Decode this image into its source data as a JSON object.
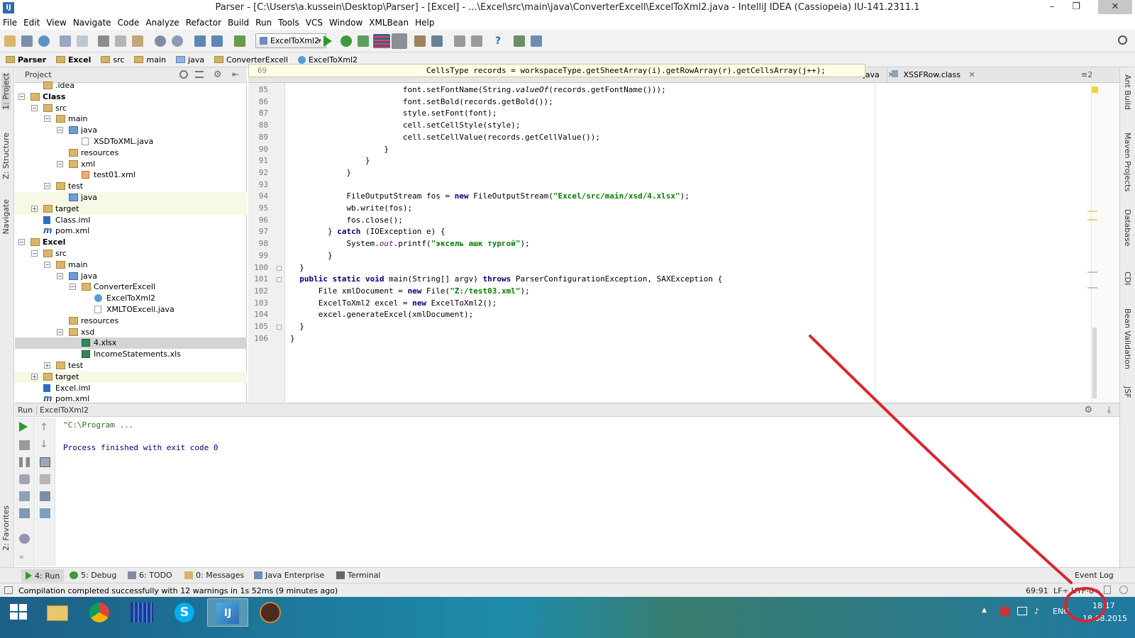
{
  "window": {
    "title": "Parser - [C:\\Users\\a.kussein\\Desktop\\Parser] - [Excel] - ...\\Excel\\src\\main\\java\\ConverterExcell\\ExcelToXml2.java - IntelliJ IDEA (Cassiopeia) IU-141.2311.1",
    "app_icon": "IJ",
    "minimize": "–",
    "maximize": "❐",
    "close": "✕"
  },
  "menu": [
    "File",
    "Edit",
    "View",
    "Navigate",
    "Code",
    "Analyze",
    "Refactor",
    "Build",
    "Run",
    "Tools",
    "VCS",
    "Window",
    "XMLBean",
    "Help"
  ],
  "toolbar": {
    "run_config": "ExcelToXml2"
  },
  "breadcrumb": [
    "Parser",
    "Excel",
    "src",
    "main",
    "java",
    "ConverterExcell",
    "ExcelToXml2"
  ],
  "left_stripe": {
    "project": "1: Project",
    "structure": "Z: Structure",
    "navigate": "Navigate",
    "favorites": "2: Favorites"
  },
  "right_stripe": [
    "Ant Build",
    "Maven Projects",
    "Database",
    "CDI",
    "Bean Validation",
    "JSF"
  ],
  "project_panel": {
    "title": "Project",
    "tree": [
      {
        "label": ".idea",
        "level": 2,
        "icon": "folder"
      },
      {
        "label": "Class",
        "level": 1,
        "icon": "folder",
        "bold": true,
        "expander": "−"
      },
      {
        "label": "src",
        "level": 2,
        "icon": "folder",
        "expander": "−"
      },
      {
        "label": "main",
        "level": 3,
        "icon": "folder",
        "expander": "−"
      },
      {
        "label": "java",
        "level": 4,
        "icon": "src",
        "expander": "−"
      },
      {
        "label": "XSDToXML.java",
        "level": 5,
        "icon": "file"
      },
      {
        "label": "resources",
        "level": 4,
        "icon": "folder"
      },
      {
        "label": "xml",
        "level": 4,
        "icon": "folder",
        "expander": "−"
      },
      {
        "label": "test01.xml",
        "level": 5,
        "icon": "xml"
      },
      {
        "label": "test",
        "level": 3,
        "icon": "folder",
        "expander": "−"
      },
      {
        "label": "java",
        "level": 4,
        "icon": "src",
        "hl": true
      },
      {
        "label": "target",
        "level": 2,
        "icon": "folder",
        "expander": "+",
        "hl": true
      },
      {
        "label": "Class.iml",
        "level": 2,
        "icon": "iml"
      },
      {
        "label": "pom.xml",
        "level": 2,
        "icon": "mvn"
      },
      {
        "label": "Excel",
        "level": 1,
        "icon": "folder",
        "bold": true,
        "expander": "−"
      },
      {
        "label": "src",
        "level": 2,
        "icon": "folder",
        "expander": "−"
      },
      {
        "label": "main",
        "level": 3,
        "icon": "folder",
        "expander": "−"
      },
      {
        "label": "java",
        "level": 4,
        "icon": "src",
        "expander": "−"
      },
      {
        "label": "ConverterExcell",
        "level": 5,
        "icon": "folder",
        "expander": "−"
      },
      {
        "label": "ExcelToXml2",
        "level": 6,
        "icon": "cls"
      },
      {
        "label": "XMLTOExcell.java",
        "level": 6,
        "icon": "file"
      },
      {
        "label": "resources",
        "level": 4,
        "icon": "folder"
      },
      {
        "label": "xsd",
        "level": 4,
        "icon": "folder",
        "expander": "−"
      },
      {
        "label": "4.xlsx",
        "level": 5,
        "icon": "xls",
        "sel": true
      },
      {
        "label": "IncomeStatements.xls",
        "level": 5,
        "icon": "xls"
      },
      {
        "label": "test",
        "level": 3,
        "icon": "folder",
        "expander": "+"
      },
      {
        "label": "target",
        "level": 2,
        "icon": "folder",
        "expander": "+",
        "hl": true
      },
      {
        "label": "Excel.iml",
        "level": 2,
        "icon": "iml"
      },
      {
        "label": "pom.xml",
        "level": 2,
        "icon": "mvn"
      }
    ]
  },
  "editor": {
    "tabs": [
      {
        "label": "...e.java",
        "icon": "file"
      },
      {
        "label": "XSSFRow.class",
        "icon": "file"
      }
    ],
    "tooltip": {
      "line": "69",
      "code": "CellsType records = workspaceType.getSheetArray(i).getRowArray(r).getCellsArray(j++);"
    },
    "lines": [
      {
        "n": "85",
        "indent": 12,
        "parts": [
          [
            "",
            "font.setFontName(String."
          ],
          [
            "i",
            "valueOf"
          ],
          [
            "",
            "(records.getFontName()));"
          ]
        ]
      },
      {
        "n": "86",
        "indent": 12,
        "parts": [
          [
            "",
            "font.setBold(records.getBold());"
          ]
        ]
      },
      {
        "n": "87",
        "indent": 12,
        "parts": [
          [
            "",
            "style.setFont(font);"
          ]
        ]
      },
      {
        "n": "88",
        "indent": 12,
        "parts": [
          [
            "",
            "cell.setCellStyle(style);"
          ]
        ]
      },
      {
        "n": "89",
        "indent": 12,
        "parts": [
          [
            "",
            "cell.setCellValue(records.getCellValue());"
          ]
        ]
      },
      {
        "n": "90",
        "indent": 10,
        "parts": [
          [
            "",
            "}"
          ]
        ]
      },
      {
        "n": "91",
        "indent": 8,
        "parts": [
          [
            "",
            "}"
          ]
        ]
      },
      {
        "n": "92",
        "indent": 6,
        "parts": [
          [
            "",
            "}"
          ]
        ]
      },
      {
        "n": "93",
        "indent": 0,
        "parts": []
      },
      {
        "n": "94",
        "indent": 6,
        "parts": [
          [
            "",
            "FileOutputStream fos = "
          ],
          [
            "k",
            "new"
          ],
          [
            "",
            " FileOutputStream("
          ],
          [
            "s",
            "\"Excel/src/main/xsd/4.xlsx\""
          ],
          [
            "",
            ");"
          ]
        ]
      },
      {
        "n": "95",
        "indent": 6,
        "parts": [
          [
            "",
            "wb.write(fos);"
          ]
        ]
      },
      {
        "n": "96",
        "indent": 6,
        "parts": [
          [
            "",
            "fos.close();"
          ]
        ]
      },
      {
        "n": "97",
        "indent": 4,
        "parts": [
          [
            "",
            "} "
          ],
          [
            "k",
            "catch"
          ],
          [
            "",
            " (IOException e) {"
          ]
        ]
      },
      {
        "n": "98",
        "indent": 6,
        "parts": [
          [
            "",
            "System."
          ],
          [
            "f",
            "out"
          ],
          [
            "",
            ".printf("
          ],
          [
            "s",
            "\"эксель ашк тургой\""
          ],
          [
            "",
            ");"
          ]
        ]
      },
      {
        "n": "99",
        "indent": 4,
        "parts": [
          [
            "",
            "}"
          ]
        ]
      },
      {
        "n": "100",
        "indent": 1,
        "parts": [
          [
            "",
            "}"
          ]
        ]
      },
      {
        "n": "101",
        "indent": 1,
        "parts": [
          [
            "k",
            "public static void"
          ],
          [
            "",
            " main(String[] argv) "
          ],
          [
            "k",
            "throws"
          ],
          [
            "",
            " ParserConfigurationException, SAXException {"
          ]
        ]
      },
      {
        "n": "102",
        "indent": 3,
        "parts": [
          [
            "",
            "File xmlDocument = "
          ],
          [
            "k",
            "new"
          ],
          [
            "",
            " File("
          ],
          [
            "s",
            "\"Z:/test03.xml\""
          ],
          [
            "",
            ");"
          ]
        ]
      },
      {
        "n": "103",
        "indent": 3,
        "parts": [
          [
            "",
            "ExcelToXml2 excel = "
          ],
          [
            "k",
            "new"
          ],
          [
            "",
            " ExcelToXml2();"
          ]
        ]
      },
      {
        "n": "104",
        "indent": 3,
        "parts": [
          [
            "",
            "excel.generateExcel(xmlDocument);"
          ]
        ]
      },
      {
        "n": "105",
        "indent": 1,
        "parts": [
          [
            "",
            "}"
          ]
        ]
      },
      {
        "n": "106",
        "indent": 0,
        "parts": [
          [
            "",
            "}"
          ]
        ]
      }
    ]
  },
  "run_panel": {
    "label": "Run",
    "config": "ExcelToXml2",
    "console_line1": "\"C:\\Program ...",
    "console_line2": "Process finished with exit code 0"
  },
  "tool_windows": {
    "run": "4: Run",
    "debug": "5: Debug",
    "todo": "6: TODO",
    "messages": "0: Messages",
    "java_enterprise": "Java Enterprise",
    "terminal": "Terminal",
    "event_log": "Event Log"
  },
  "status": {
    "message": "Compilation completed successfully with 12 warnings in 1s 52ms (9 minutes ago)",
    "position": "69:91",
    "line_sep": "LF÷",
    "encoding": "UTF-8÷"
  },
  "taskbar": {
    "lang": "ENG",
    "time": "18:17",
    "date": "18.08.2015"
  },
  "colors": {
    "annotation": "#d9262f",
    "keyword": "#000080",
    "string": "#008000"
  }
}
